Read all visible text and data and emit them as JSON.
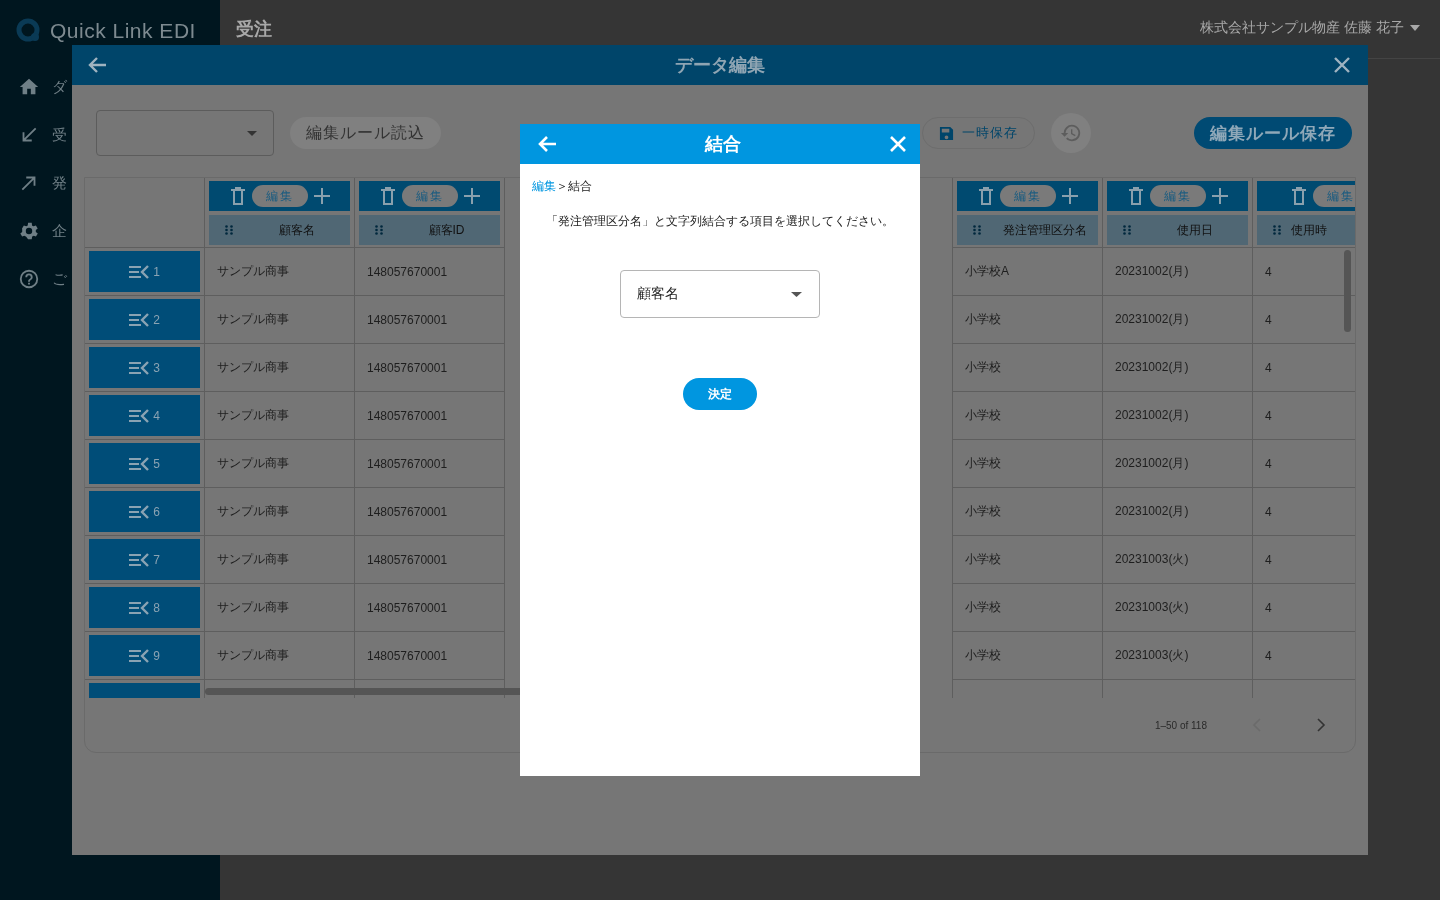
{
  "sidebar": {
    "logo": "Quick Link EDI",
    "items": [
      {
        "label": "ダ"
      },
      {
        "label": "受"
      },
      {
        "label": "発"
      },
      {
        "label": "企"
      },
      {
        "label": "ご"
      }
    ]
  },
  "header": {
    "title": "受注",
    "user": "株式会社サンプル物産 佐藤 花子"
  },
  "editor": {
    "title": "データ編集",
    "load_button": {
      "label": "編集ルール読込",
      "disabled": true
    },
    "temp_save_button": "一時保存",
    "save_rule_button": "編集ルール保存",
    "table": {
      "columns": [
        {
          "title": "顧客名",
          "edit_label": "編集"
        },
        {
          "title": "顧客ID",
          "edit_label": "編集"
        },
        {
          "title": "発注管理区分名",
          "edit_label": "編集"
        },
        {
          "title": "使用日",
          "edit_label": "編集"
        },
        {
          "title": "使用時",
          "edit_label": "編集"
        }
      ],
      "rows": [
        {
          "number": "1",
          "cells": [
            "サンプル商事",
            "148057670001",
            "小学校A",
            "20231002(月)",
            "4"
          ]
        },
        {
          "number": "2",
          "cells": [
            "サンプル商事",
            "148057670001",
            "小学校",
            "20231002(月)",
            "4"
          ]
        },
        {
          "number": "3",
          "cells": [
            "サンプル商事",
            "148057670001",
            "小学校",
            "20231002(月)",
            "4"
          ]
        },
        {
          "number": "4",
          "cells": [
            "サンプル商事",
            "148057670001",
            "小学校",
            "20231002(月)",
            "4"
          ]
        },
        {
          "number": "5",
          "cells": [
            "サンプル商事",
            "148057670001",
            "小学校",
            "20231002(月)",
            "4"
          ]
        },
        {
          "number": "6",
          "cells": [
            "サンプル商事",
            "148057670001",
            "小学校",
            "20231002(月)",
            "4"
          ]
        },
        {
          "number": "7",
          "cells": [
            "サンプル商事",
            "148057670001",
            "小学校",
            "20231003(火)",
            "4"
          ]
        },
        {
          "number": "8",
          "cells": [
            "サンプル商事",
            "148057670001",
            "小学校",
            "20231003(火)",
            "4"
          ]
        },
        {
          "number": "9",
          "cells": [
            "サンプル商事",
            "148057670001",
            "小学校",
            "20231003(火)",
            "4"
          ]
        }
      ],
      "pagination": "1–50 of 118"
    }
  },
  "modal": {
    "title": "結合",
    "breadcrumb_link": "編集",
    "breadcrumb_current": "＞結合",
    "instruction": "「発注管理区分名」と文字列結合する項目を選択してください。",
    "select": {
      "value": "顧客名"
    },
    "submit_button": "決定"
  }
}
